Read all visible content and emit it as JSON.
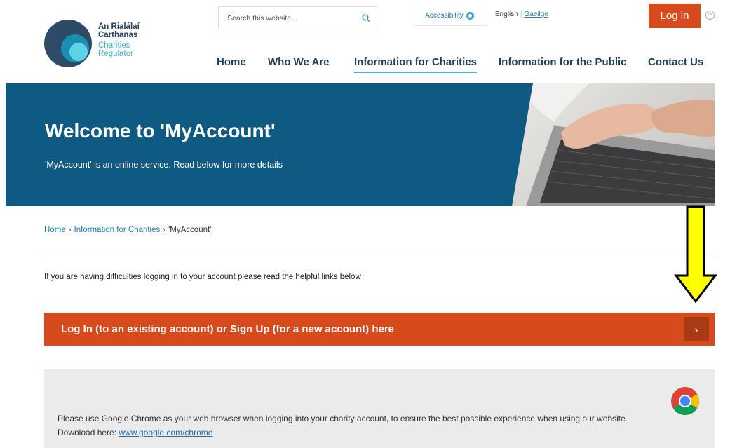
{
  "header": {
    "logo": {
      "irish_line1": "An Rialálaí",
      "irish_line2": "Carthanas",
      "english_line1": "Charities",
      "english_line2": "Regulator"
    },
    "search": {
      "placeholder": "Search this website..."
    },
    "accessibility_label": "Accessibility",
    "lang": {
      "english": "English",
      "gaeilge": "Gaeilge"
    },
    "login_label": "Log in",
    "help_glyph": "?"
  },
  "nav": {
    "items": [
      {
        "label": "Home"
      },
      {
        "label": "Who We Are"
      },
      {
        "label": "Information for Charities"
      },
      {
        "label": "Information for the Public"
      },
      {
        "label": "Contact Us"
      }
    ],
    "active": "Information for Charities"
  },
  "hero": {
    "title": "Welcome to 'MyAccount'",
    "subtitle": "'MyAccount' is an online service. Read below for more details"
  },
  "breadcrumb": {
    "items": [
      "Home",
      "Information for Charities",
      "'MyAccount'"
    ],
    "separator": "›"
  },
  "intro_text": "If you are having difficulties logging in to your account please read the helpful links below",
  "cta": {
    "label": "Log In (to an existing account) or Sign Up (for a new account) here",
    "arrow": "›"
  },
  "notice": {
    "text": "Please use Google Chrome as your web browser when logging into your charity account, to ensure the best possible experience when using our website. Download here: ",
    "link": "www.google.com/chrome"
  },
  "colors": {
    "brand_dark": "#1f3f5b",
    "brand_accent": "#3cb8d0",
    "hero_bg": "#0f5a82",
    "cta_bg": "#d74a1c",
    "annotation": "#ffff00"
  }
}
